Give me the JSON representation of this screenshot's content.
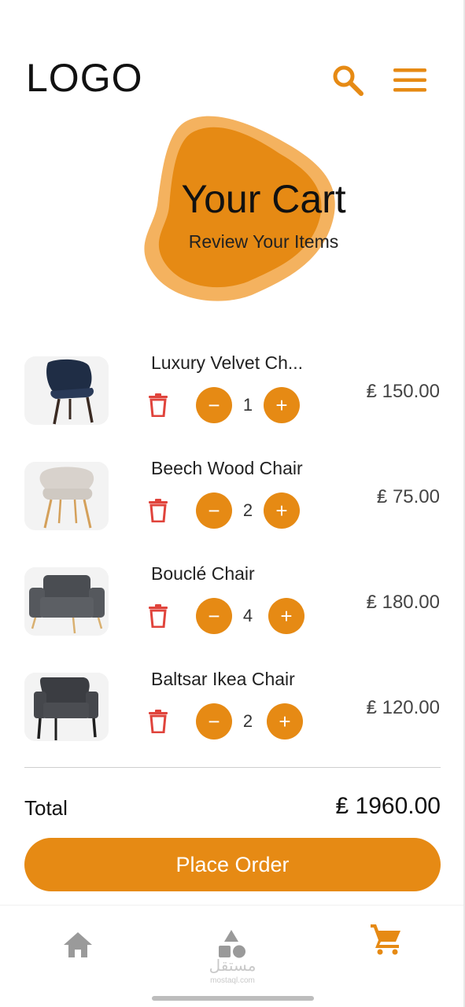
{
  "header": {
    "logo": "LOGO",
    "search_icon": "search-icon",
    "menu_icon": "hamburger-menu-icon"
  },
  "hero": {
    "title": "Your Cart",
    "subtitle": "Review Your Items"
  },
  "cart": {
    "items": [
      {
        "name": "Luxury Velvet Ch...",
        "quantity": "1",
        "price": "₤ 150.00",
        "image": "navy-velvet-chair"
      },
      {
        "name": "Beech Wood Chair",
        "quantity": "2",
        "price": "₤ 75.00",
        "image": "beige-beech-chair"
      },
      {
        "name": "Bouclé Chair",
        "quantity": "4",
        "price": "₤ 180.00",
        "image": "grey-armchair"
      },
      {
        "name": "Baltsar Ikea Chair",
        "quantity": "2",
        "price": "₤ 120.00",
        "image": "dark-grey-armchair"
      }
    ],
    "minus_symbol": "−",
    "plus_symbol": "+"
  },
  "summary": {
    "total_label": "Total",
    "total_value": "₤ 1960.00"
  },
  "actions": {
    "place_order_label": "Place Order"
  },
  "bottom_nav": {
    "items": [
      "home-icon",
      "categories-icon",
      "cart-icon"
    ],
    "active": "cart-icon"
  },
  "watermark": {
    "arabic": "مستقل",
    "latin": "mostaql.com"
  },
  "colors": {
    "accent": "#e68a14",
    "accent_light": "#f4b25f",
    "trash": "#e0443c",
    "nav_inactive": "#9a9a9a"
  }
}
